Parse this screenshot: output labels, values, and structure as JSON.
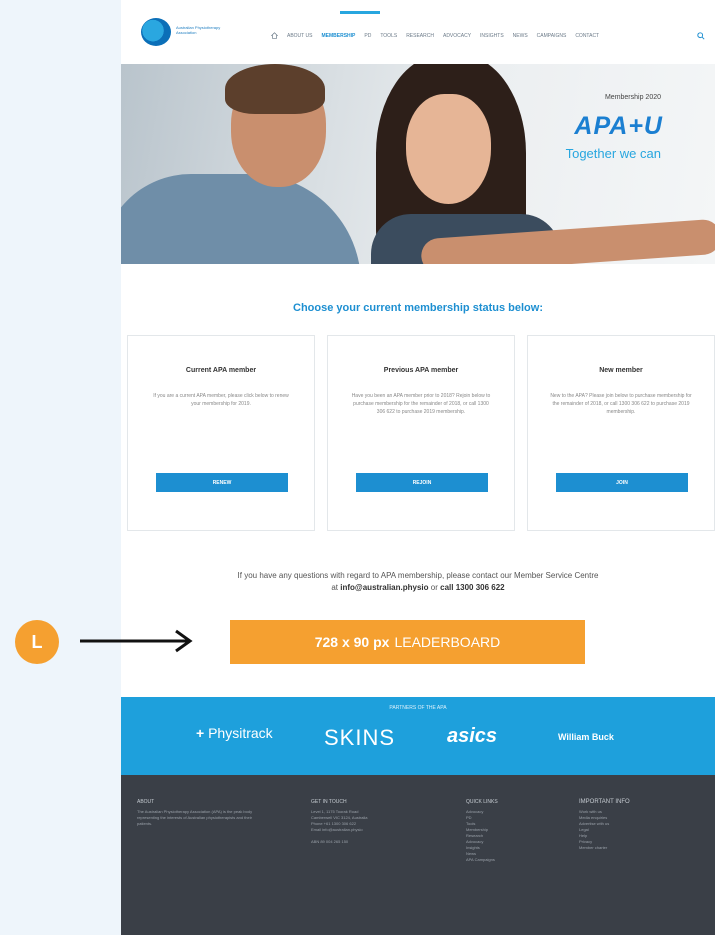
{
  "header": {
    "logo_text": "Australian Physiotherapy Association",
    "nav": [
      "ABOUT US",
      "MEMBERSHIP",
      "PD",
      "TOOLS",
      "RESEARCH",
      "ADVOCACY",
      "INSIGHTS",
      "NEWS",
      "CAMPAIGNS",
      "CONTACT"
    ]
  },
  "hero": {
    "kicker": "Membership 2020",
    "brand": "APA+U",
    "tagline": "Together we can"
  },
  "section_title": "Choose your current membership status below:",
  "cards": [
    {
      "title": "Current APA member",
      "body": "If you are a current APA member, please click below to renew your membership for 2019.",
      "button": "RENEW"
    },
    {
      "title": "Previous APA member",
      "body": "Have you been an APA member prior to 2018? Rejoin below to purchase membership for the remainder of 2018, or call 1300 306 622 to purchase 2019 membership.",
      "button": "REJOIN"
    },
    {
      "title": "New member",
      "body": "New to the APA? Please join below to purchase membership for the remainder of 2018, or call 1300 306 622 to purchase 2019 membership.",
      "button": "JOIN"
    }
  ],
  "contact": {
    "line1": "If you have any questions with regard to APA membership, please contact our Member Service Centre",
    "at": "at",
    "email": "info@australian.physio",
    "or": "or",
    "phone": "call 1300 306 622"
  },
  "leaderboard": {
    "size": "728 x 90 px",
    "label": "LEADERBOARD"
  },
  "marker": {
    "letter": "L"
  },
  "partners": {
    "title": "PARTNERS OF THE APA",
    "logos": [
      "Physitrack",
      "SKINS",
      "asics",
      "William Buck"
    ]
  },
  "footer": {
    "col1_title": "ABOUT",
    "col1_text": "The Australian Physiotherapy Association (APA) is the peak body representing the interests of Australian physiotherapists and their patients.",
    "col2_title": "GET IN TOUCH",
    "col2_items": [
      "Level 1, 1175 Toorak Road",
      "Camberwell VIC 3124, Australia",
      "Phone +61 1300 306 622",
      "Email info@australian.physio",
      "ABN 89 004 265 150"
    ],
    "col3_title": "QUICK LINKS",
    "col3_items": [
      "Advocacy",
      "PD",
      "Tools",
      "Membership",
      "Research",
      "Advocacy",
      "Insights",
      "News",
      "APA Campaigns"
    ],
    "col4_title": "IMPORTANT INFO",
    "col4_items": [
      "Work with us",
      "Media enquiries",
      "Advertise with us",
      "Legal",
      "Help",
      "Privacy",
      "Member charter"
    ]
  },
  "colors": {
    "brand_blue": "#1d8fd1",
    "accent_orange": "#f5a030",
    "footer_dark": "#3a3f47"
  }
}
